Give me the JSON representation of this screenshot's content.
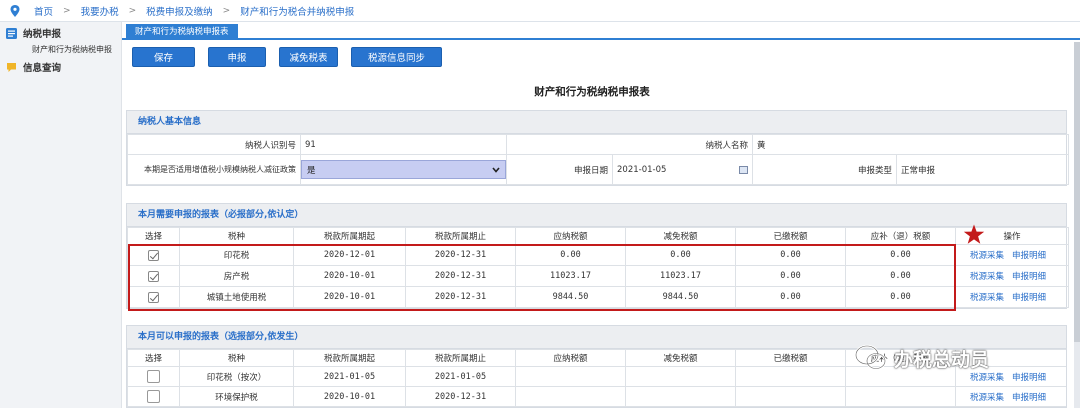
{
  "breadcrumb": [
    "首页",
    "我要办税",
    "税费申报及缴纳",
    "财产和行为税合并纳税申报"
  ],
  "breadcrumb_sep": ">",
  "sidebar": {
    "groups": [
      {
        "title": "纳税申报",
        "icon": "report-icon",
        "items": [
          "财产和行为税纳税申报"
        ]
      },
      {
        "title": "信息查询",
        "icon": "chat-icon",
        "items": []
      }
    ]
  },
  "tab": {
    "label": "财产和行为税纳税申报表"
  },
  "toolbar": {
    "save": "保存",
    "declare": "申报",
    "reduce": "减免税表",
    "sync": "税源信息同步"
  },
  "report_title": "财产和行为税纳税申报表",
  "basic": {
    "section_title": "纳税人基本信息",
    "taxpayer_id_label": "纳税人识别号",
    "taxpayer_id_value": "91",
    "taxpayer_name_label": "纳税人名称",
    "taxpayer_name_value": "黄",
    "small_scale_label": "本期是否适用增值税小规模纳税人减征政策",
    "small_scale_value": "是",
    "date_label": "申报日期",
    "date_value": "2021-01-05",
    "type_label": "申报类型",
    "type_value": "正常申报"
  },
  "required": {
    "section_title": "本月需要申报的报表（必报部分,依认定）",
    "headers": [
      "选择",
      "税种",
      "税款所属期起",
      "税款所属期止",
      "应纳税额",
      "减免税额",
      "已缴税额",
      "应补（退）税额",
      "操作"
    ],
    "rows": [
      {
        "tax": "印花税",
        "start": "2020-12-01",
        "end": "2020-12-31",
        "payable": "0.00",
        "reduce": "0.00",
        "paid": "0.00",
        "due": "0.00"
      },
      {
        "tax": "房产税",
        "start": "2020-10-01",
        "end": "2020-12-31",
        "payable": "11023.17",
        "reduce": "11023.17",
        "paid": "0.00",
        "due": "0.00"
      },
      {
        "tax": "城镇土地使用税",
        "start": "2020-10-01",
        "end": "2020-12-31",
        "payable": "9844.50",
        "reduce": "9844.50",
        "paid": "0.00",
        "due": "0.00"
      }
    ],
    "actions": [
      "税源采集",
      "申报明细"
    ]
  },
  "optional": {
    "section_title": "本月可以申报的报表（选报部分,依发生）",
    "headers": [
      "选择",
      "税种",
      "税款所属期起",
      "税款所属期止",
      "应纳税额",
      "减免税额",
      "已缴税额",
      "应补（退）税额"
    ],
    "rows": [
      {
        "tax": "印花税（按次）",
        "start": "2021-01-05",
        "end": "2021-01-05"
      },
      {
        "tax": "环境保护税",
        "start": "2020-10-01",
        "end": "2020-12-31"
      }
    ],
    "actions": [
      "税源采集",
      "申报明细"
    ]
  },
  "watermark": "办税总动员",
  "colors": {
    "accent": "#2874cf",
    "highlight": "#c31a1a",
    "select_bg": "#c7cdf2"
  }
}
